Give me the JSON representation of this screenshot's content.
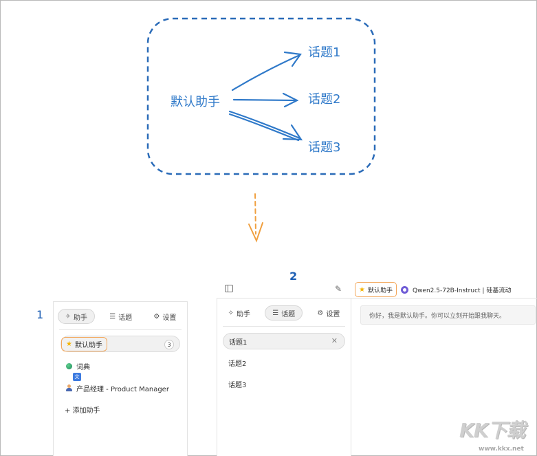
{
  "diagram": {
    "source": "默认助手",
    "targets": [
      "话题1",
      "话题2",
      "话题3"
    ]
  },
  "annotations": {
    "step1": "1",
    "step2": "2"
  },
  "left_panel": {
    "tabs": [
      {
        "icon": "sparkle-icon",
        "label": "助手",
        "active": true
      },
      {
        "icon": "list-icon",
        "label": "话题",
        "active": false
      },
      {
        "icon": "gear-icon",
        "label": "设置",
        "active": false
      }
    ],
    "assistants": [
      {
        "icon": "star-icon",
        "label": "默认助手",
        "count": "3",
        "selected": true
      },
      {
        "icon": "globe-icon",
        "label": "词典"
      },
      {
        "icon": "person-icon",
        "label": "产品经理 - Product Manager"
      }
    ],
    "add_label": "+ 添加助手"
  },
  "mid_panel": {
    "tabs": [
      {
        "icon": "sparkle-icon",
        "label": "助手",
        "active": false
      },
      {
        "icon": "list-icon",
        "label": "话题",
        "active": true
      },
      {
        "icon": "gear-icon",
        "label": "设置",
        "active": false
      }
    ],
    "topics": [
      {
        "label": "话题1",
        "selected": true
      },
      {
        "label": "话题2"
      },
      {
        "label": "话题3"
      }
    ]
  },
  "chat": {
    "assistant_label": "默认助手",
    "model_label": "Qwen2.5-72B-Instruct | 硅基流动",
    "greeting": "你好，我是默认助手。你可以立刻开始跟我聊天。"
  },
  "watermark": {
    "main": "KK下载",
    "sub": "www.kkx.net"
  },
  "colors": {
    "diagram_blue": "#2f79c9",
    "arrow_orange": "#f0a040",
    "highlight_orange": "#f3a75a",
    "annotation_blue": "#1e5fb4"
  }
}
